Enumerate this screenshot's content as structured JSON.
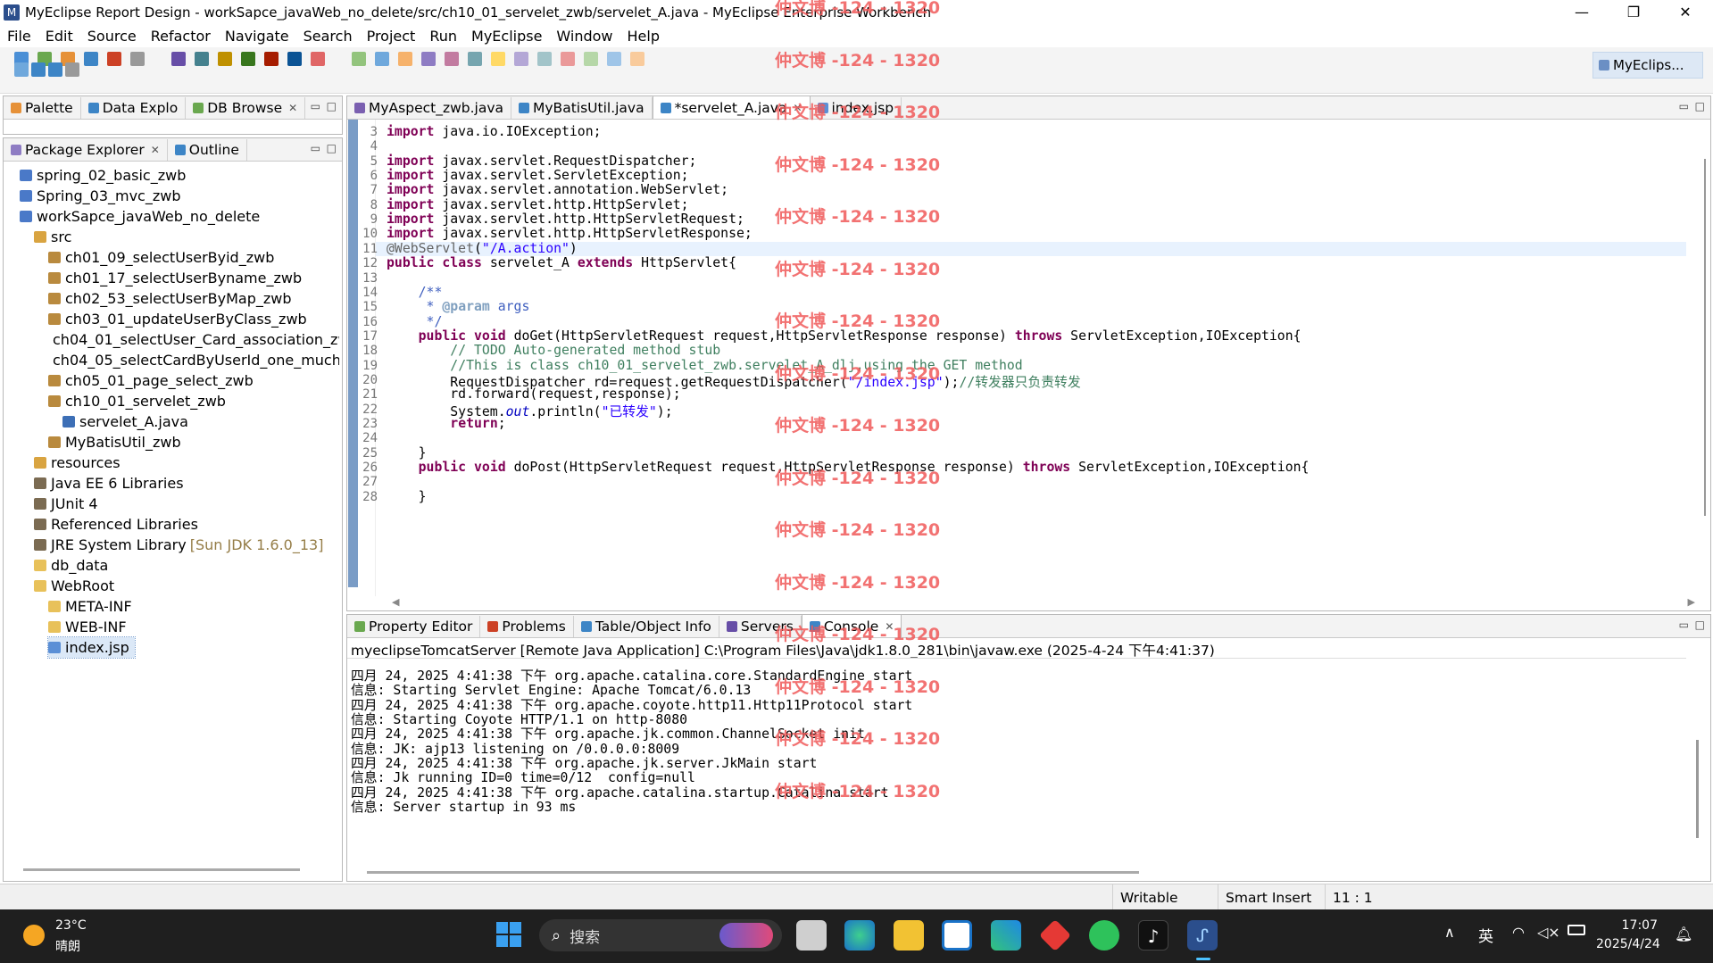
{
  "window": {
    "title": "MyEclipse Report Design - workSapce_javaWeb_no_delete/src/ch10_01_servelet_zwb/servelet_A.java - MyEclipse Enterprise Workbench",
    "minimize": "—",
    "maximize": "❐",
    "close": "✕"
  },
  "menu": [
    "File",
    "Edit",
    "Source",
    "Refactor",
    "Navigate",
    "Search",
    "Project",
    "Run",
    "MyEclipse",
    "Window",
    "Help"
  ],
  "perspective": {
    "label": "MyEclips..."
  },
  "left_top_tabs": [
    {
      "label": "Palette"
    },
    {
      "label": "Data Explo"
    },
    {
      "label": "DB Browse",
      "close": "✕"
    }
  ],
  "left_tabs": [
    {
      "label": "Package Explorer",
      "close": "✕"
    },
    {
      "label": "Outline"
    }
  ],
  "tree": [
    {
      "label": "spring_02_basic_zwb",
      "indent": 1,
      "icon": "project"
    },
    {
      "label": "Spring_03_mvc_zwb",
      "indent": 1,
      "icon": "project"
    },
    {
      "label": "workSapce_javaWeb_no_delete",
      "indent": 1,
      "icon": "project"
    },
    {
      "label": "src",
      "indent": 2,
      "icon": "srcfolder"
    },
    {
      "label": "ch01_09_selectUserByid_zwb",
      "indent": 3,
      "icon": "package"
    },
    {
      "label": "ch01_17_selectUserByname_zwb",
      "indent": 3,
      "icon": "package"
    },
    {
      "label": "ch02_53_selectUserByMap_zwb",
      "indent": 3,
      "icon": "package"
    },
    {
      "label": "ch03_01_updateUserByClass_zwb",
      "indent": 3,
      "icon": "package"
    },
    {
      "label": "ch04_01_selectUser_Card_association_zw",
      "indent": 3,
      "icon": "package"
    },
    {
      "label": "ch04_05_selectCardByUserId_one_much_",
      "indent": 3,
      "icon": "package"
    },
    {
      "label": "ch05_01_page_select_zwb",
      "indent": 3,
      "icon": "package"
    },
    {
      "label": "ch10_01_servelet_zwb",
      "indent": 3,
      "icon": "package"
    },
    {
      "label": "servelet_A.java",
      "indent": 4,
      "icon": "java"
    },
    {
      "label": "MyBatisUtil_zwb",
      "indent": 3,
      "icon": "package"
    },
    {
      "label": "resources",
      "indent": 2,
      "icon": "srcfolder"
    },
    {
      "label": "Java EE 6 Libraries",
      "indent": 2,
      "icon": "library"
    },
    {
      "label": "JUnit 4",
      "indent": 2,
      "icon": "library"
    },
    {
      "label": "Referenced Libraries",
      "indent": 2,
      "icon": "library"
    },
    {
      "label": "JRE System Library",
      "suffix": "[Sun JDK 1.6.0_13]",
      "indent": 2,
      "icon": "library"
    },
    {
      "label": "db_data",
      "indent": 2,
      "icon": "folder"
    },
    {
      "label": "WebRoot",
      "indent": 2,
      "icon": "folder"
    },
    {
      "label": "META-INF",
      "indent": 3,
      "icon": "folder"
    },
    {
      "label": "WEB-INF",
      "indent": 3,
      "icon": "folder"
    },
    {
      "label": "index.jsp",
      "indent": 3,
      "icon": "jsp",
      "selected": true
    }
  ],
  "editor_tabs": [
    {
      "label": "MyAspect_zwb.java"
    },
    {
      "label": "MyBatisUtil.java"
    },
    {
      "label": "*servelet_A.java",
      "active": true,
      "close": "✕"
    },
    {
      "label": "index.jsp"
    }
  ],
  "code_lines": [
    {
      "n": "3",
      "html": "<span class='kw'>import</span> java.io.IOException;"
    },
    {
      "n": "4",
      "html": ""
    },
    {
      "n": "5",
      "html": "<span class='kw'>import</span> javax.servlet.RequestDispatcher;"
    },
    {
      "n": "6",
      "html": "<span class='kw'>import</span> javax.servlet.ServletException;"
    },
    {
      "n": "7",
      "html": "<span class='kw'>import</span> javax.servlet.annotation.WebServlet;"
    },
    {
      "n": "8",
      "html": "<span class='kw'>import</span> javax.servlet.http.HttpServlet;"
    },
    {
      "n": "9",
      "html": "<span class='kw'>import</span> javax.servlet.http.HttpServletRequest;"
    },
    {
      "n": "10",
      "html": "<span class='kw'>import</span> javax.servlet.http.HttpServletResponse;"
    },
    {
      "n": "11",
      "html": "<span class='ann'>@WebServlet</span>(<span class='str'>\"/A.action\"</span>)",
      "current": true
    },
    {
      "n": "12",
      "html": "<span class='kw'>public</span> <span class='kw'>class</span> servelet_A <span class='kw'>extends</span> HttpServlet{"
    },
    {
      "n": "13",
      "html": ""
    },
    {
      "n": "14",
      "html": "    <span class='jd'>/**</span>"
    },
    {
      "n": "15",
      "html": "     <span class='jd'>* </span><span class='jdt'>@param</span><span class='jd'> args</span>"
    },
    {
      "n": "16",
      "html": "     <span class='jd'>*/</span>"
    },
    {
      "n": "17",
      "html": "    <span class='kw'>public</span> <span class='kw'>void</span> doGet(HttpServletRequest request,HttpServletResponse response) <span class='kw'>throws</span> ServletException,IOException{"
    },
    {
      "n": "18",
      "html": "        <span class='cm'>// TODO Auto-generated method stub</span>"
    },
    {
      "n": "19",
      "html": "        <span class='cm'>//This is class ch10_01_servelet_zwb.servelet_A_dlj,using the GET method</span>"
    },
    {
      "n": "20",
      "html": "        RequestDispatcher rd=request.getRequestDispatcher(<span class='str'>\"/index.jsp\"</span>);<span class='cm'>//转发器只负责转发</span>"
    },
    {
      "n": "21",
      "html": "        rd.forward(request,response);"
    },
    {
      "n": "22",
      "html": "        System.<span class='it'>out</span>.println(<span class='str'>\"已转发\"</span>);"
    },
    {
      "n": "23",
      "html": "        <span class='kw'>return</span>;"
    },
    {
      "n": "24",
      "html": ""
    },
    {
      "n": "25",
      "html": "    }"
    },
    {
      "n": "26",
      "html": "    <span class='kw'>public</span> <span class='kw'>void</span> doPost(HttpServletRequest request,HttpServletResponse response) <span class='kw'>throws</span> ServletException,IOException{"
    },
    {
      "n": "27",
      "html": ""
    },
    {
      "n": "28",
      "html": "    }"
    }
  ],
  "bottom_tabs": [
    {
      "label": "Property Editor"
    },
    {
      "label": "Problems"
    },
    {
      "label": "Table/Object Info"
    },
    {
      "label": "Servers"
    },
    {
      "label": "Console",
      "active": true,
      "close": "✕"
    }
  ],
  "console": {
    "header": "myeclipseTomcatServer [Remote Java Application] C:\\Program Files\\Java\\jdk1.8.0_281\\bin\\javaw.exe (2025-4-24 下午4:41:37)",
    "lines": [
      "四月 24, 2025 4:41:38 下午 org.apache.catalina.core.StandardEngine start",
      "信息: Starting Servlet Engine: Apache Tomcat/6.0.13",
      "四月 24, 2025 4:41:38 下午 org.apache.coyote.http11.Http11Protocol start",
      "信息: Starting Coyote HTTP/1.1 on http-8080",
      "四月 24, 2025 4:41:38 下午 org.apache.jk.common.ChannelSocket init",
      "信息: JK: ajp13 listening on /0.0.0.0:8009",
      "四月 24, 2025 4:41:38 下午 org.apache.jk.server.JkMain start",
      "信息: Jk running ID=0 time=0/12  config=null",
      "四月 24, 2025 4:41:38 下午 org.apache.catalina.startup.Catalina start",
      "信息: Server startup in 93 ms"
    ]
  },
  "watermark": "仲文博 -124 - 1320",
  "status": {
    "writable": "Writable",
    "insert": "Smart Insert",
    "position": "11 : 1"
  },
  "taskbar": {
    "weather_temp": "23°C",
    "weather_desc": "晴朗",
    "search_placeholder": "搜索",
    "ime": "英",
    "time": "17:07",
    "date": "2025/4/24"
  }
}
